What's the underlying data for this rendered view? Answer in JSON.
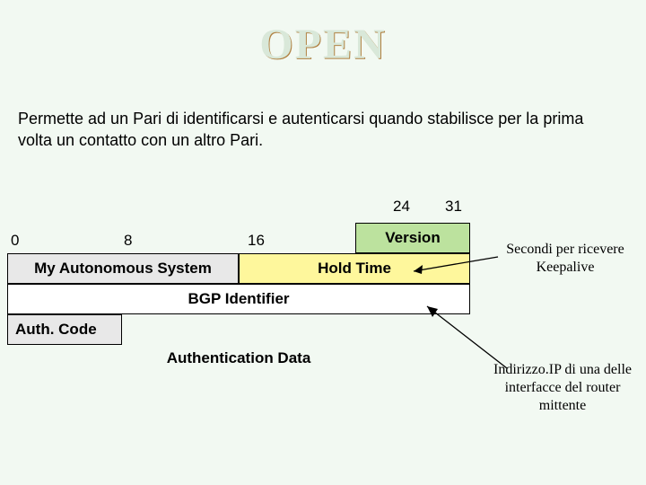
{
  "title": "OPEN",
  "description": "Permette ad un Pari di identificarsi e autenticarsi quando stabilisce per la prima volta un contatto con un altro Pari.",
  "bits": {
    "b0": "0",
    "b8": "8",
    "b16": "16",
    "b24": "24",
    "b31": "31"
  },
  "fields": {
    "version": "Version",
    "my_as": "My Autonomous System",
    "hold_time": "Hold Time",
    "bgp_id": "BGP Identifier",
    "auth_code": "Auth. Code",
    "auth_data": "Authentication Data"
  },
  "annotations": {
    "keepalive": "Secondi per ricevere Keepalive",
    "router_ip": "Indirizzo.IP di una delle interfacce del router mittente"
  }
}
